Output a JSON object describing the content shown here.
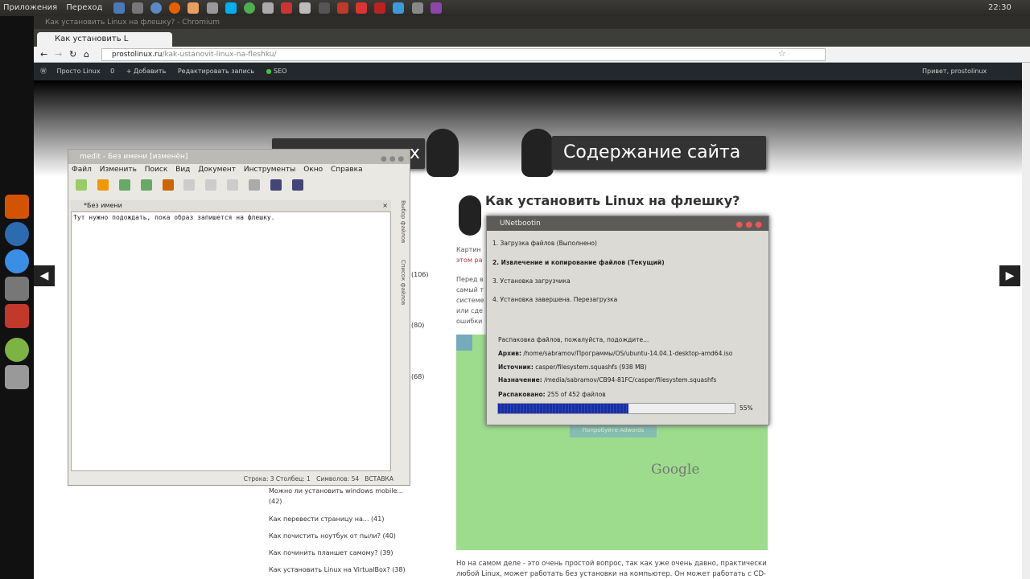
{
  "panel": {
    "apps": "Приложения",
    "go": "Переход",
    "time": "22:30"
  },
  "browser": {
    "window_title": "Как установить Linux на флешку? - Chromium",
    "tab_title": "Как установить L",
    "url_domain": "prostolinux.ru",
    "url_path": "/kak-ustanovit-linux-na-fleshku/"
  },
  "wp": {
    "site": "Просто Linux",
    "comments": "0",
    "add": "+ Добавить",
    "edit": "Редактировать запись",
    "seo": "SEO",
    "greeting": "Привет, prostolinux"
  },
  "site": {
    "contents_banner": "Содержание сайта",
    "banner_x": "x",
    "post_title": "Как установить Linux на флешку?",
    "google": "Google",
    "try_btn": "Попробуйте Adwords"
  },
  "sidebar": [
    {
      "text": "Можно ли установить windows mobile...",
      "count": "(42)"
    },
    {
      "text": "Как перевести страницу на...",
      "count": "(41)"
    },
    {
      "text": "Как почистить ноутбук от пыли?",
      "count": "(40)"
    },
    {
      "text": "Как починить планшет самому?",
      "count": "(39)"
    },
    {
      "text": "Как установить Linux на VirtualBox?",
      "count": "(38)"
    }
  ],
  "side_counts": [
    "(106)",
    "(80)",
    "(68)"
  ],
  "article_fragments": {
    "p1a": "Картин",
    "p1b": "этом ра",
    "p2a": "Перед в",
    "p2b": "самый т",
    "p2c": "системе",
    "p2d": "или сде",
    "p2e": "ошибки",
    "bottom1": "Но на самом деле - это очень простой вопрос, так как уже очень давно, практически",
    "bottom2": "любой Linux, может работать без установки на компьютер. Он может работать с CD-"
  },
  "medit": {
    "title": "medit - Без имени [изменён]",
    "menu": [
      "Файл",
      "Изменить",
      "Поиск",
      "Вид",
      "Документ",
      "Инструменты",
      "Окно",
      "Справка"
    ],
    "doc_tab": "*Без имени",
    "text": "Тут нужно подождать, пока образ запишется на флешку.",
    "side_tab1": "Выбор файлов",
    "side_tab2": "Список файлов",
    "status_pos": "Строка: 3 Столбец: 1",
    "status_chars": "Символов: 54",
    "status_mode": "ВСТАВКА"
  },
  "unetbootin": {
    "title": "UNetbootin",
    "steps": [
      "1. Загрузка файлов (Выполнено)",
      "2. Извлечение и копирование файлов (Текущий)",
      "3. Установка загрузчика",
      "4. Установка завершена. Перезагрузка"
    ],
    "status": "Распаковка файлов, пожалуйста, подождите...",
    "archive_label": "Архив:",
    "archive": "/home/sabramov/Программы/OS/ubuntu-14.04.1-desktop-amd64.iso",
    "source_label": "Источник:",
    "source": "casper/filesystem.squashfs (938 MB)",
    "dest_label": "Назначение:",
    "dest": "/media/sabramov/CB94-81FC/casper/filesystem.squashfs",
    "unpacked_label": "Распаковано:",
    "unpacked": "255 of 452 файлов",
    "progress": 0.55,
    "progress_text": "55%"
  }
}
